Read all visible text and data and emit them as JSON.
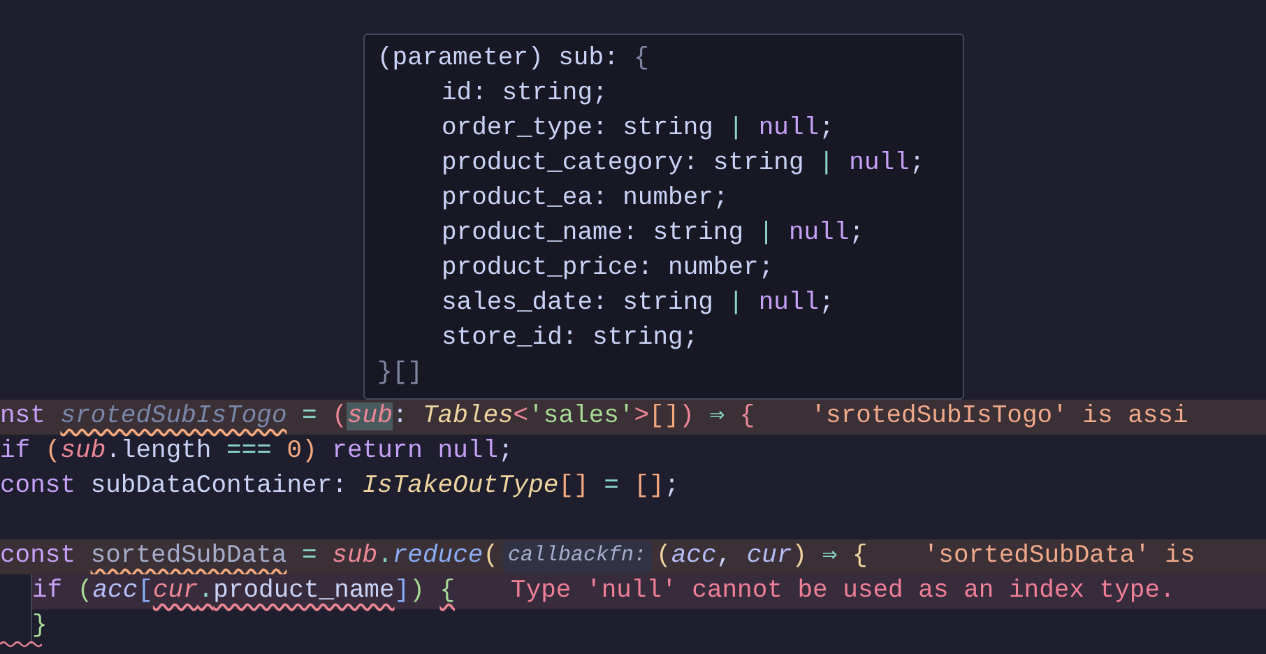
{
  "hover": {
    "lines": [
      {
        "indented": false,
        "tokens": [
          {
            "text": "(parameter) sub: ",
            "kind": "plain"
          },
          {
            "text": "{",
            "kind": "punct-grey"
          }
        ]
      },
      {
        "indented": true,
        "tokens": [
          {
            "text": "id: string;",
            "kind": "plain"
          }
        ]
      },
      {
        "indented": true,
        "tokens": [
          {
            "text": "order_type: string ",
            "kind": "plain"
          },
          {
            "text": "|",
            "kind": "operator"
          },
          {
            "text": " null",
            "kind": "keyword"
          },
          {
            "text": ";",
            "kind": "plain"
          }
        ]
      },
      {
        "indented": true,
        "tokens": [
          {
            "text": "product_category: string ",
            "kind": "plain"
          },
          {
            "text": "|",
            "kind": "operator"
          },
          {
            "text": " null",
            "kind": "keyword"
          },
          {
            "text": ";",
            "kind": "plain"
          }
        ]
      },
      {
        "indented": true,
        "tokens": [
          {
            "text": "product_ea: number;",
            "kind": "plain"
          }
        ]
      },
      {
        "indented": true,
        "tokens": [
          {
            "text": "product_name: string ",
            "kind": "plain"
          },
          {
            "text": "|",
            "kind": "operator"
          },
          {
            "text": " null",
            "kind": "keyword"
          },
          {
            "text": ";",
            "kind": "plain"
          }
        ]
      },
      {
        "indented": true,
        "tokens": [
          {
            "text": "product_price: number;",
            "kind": "plain"
          }
        ]
      },
      {
        "indented": true,
        "tokens": [
          {
            "text": "sales_date: string ",
            "kind": "plain"
          },
          {
            "text": "|",
            "kind": "operator"
          },
          {
            "text": " null",
            "kind": "keyword"
          },
          {
            "text": ";",
            "kind": "plain"
          }
        ]
      },
      {
        "indented": true,
        "tokens": [
          {
            "text": "store_id: string;",
            "kind": "plain"
          }
        ]
      },
      {
        "indented": false,
        "tokens": [
          {
            "text": "}[]",
            "kind": "punct-grey"
          }
        ]
      }
    ]
  },
  "code_lines": [
    {
      "kind": "warning",
      "indented": false,
      "diagnostic": "'srotedSubIsTogo' is assi",
      "tokens": [
        {
          "text": "nst ",
          "kind": "keyword"
        },
        {
          "text": "srotedSubIsTogo",
          "kind": "unused",
          "squiggle": true
        },
        {
          "text": " = ",
          "kind": "operator"
        },
        {
          "text": "(",
          "kind": "punct-pink"
        },
        {
          "text": "sub",
          "kind": "param",
          "highlight": true
        },
        {
          "text": ": ",
          "kind": "plain"
        },
        {
          "text": "Tables",
          "kind": "type"
        },
        {
          "text": "<",
          "kind": "punct-pink"
        },
        {
          "text": "'sales'",
          "kind": "string"
        },
        {
          "text": ">",
          "kind": "punct-pink"
        },
        {
          "text": "[]",
          "kind": "punct-orange"
        },
        {
          "text": ")",
          "kind": "punct-pink"
        },
        {
          "text": " ⇒ ",
          "kind": "operator"
        },
        {
          "text": "{",
          "kind": "punct-pink"
        }
      ]
    },
    {
      "kind": "normal",
      "indented": false,
      "tokens": [
        {
          "text": "if ",
          "kind": "keyword"
        },
        {
          "text": "(",
          "kind": "punct-orange"
        },
        {
          "text": "sub",
          "kind": "param"
        },
        {
          "text": ".length ",
          "kind": "plain"
        },
        {
          "text": "===",
          "kind": "operator"
        },
        {
          "text": " 0",
          "kind": "number"
        },
        {
          "text": ") ",
          "kind": "punct-orange"
        },
        {
          "text": "return null",
          "kind": "keyword"
        },
        {
          "text": ";",
          "kind": "plain"
        }
      ]
    },
    {
      "kind": "normal",
      "indented": false,
      "tokens": [
        {
          "text": "const ",
          "kind": "keyword"
        },
        {
          "text": "subDataContainer: ",
          "kind": "plain"
        },
        {
          "text": "IsTakeOutType",
          "kind": "type"
        },
        {
          "text": "[]",
          "kind": "punct-orange"
        },
        {
          "text": " = ",
          "kind": "operator"
        },
        {
          "text": "[]",
          "kind": "punct-orange"
        },
        {
          "text": ";",
          "kind": "plain"
        }
      ]
    },
    {
      "kind": "normal",
      "indented": false
    },
    {
      "kind": "warning",
      "indented": false,
      "diagnostic": "'sortedSubData' is",
      "tokens": [
        {
          "text": "const ",
          "kind": "keyword"
        },
        {
          "text": "sortedSubData",
          "kind": "dim",
          "squiggle": true
        },
        {
          "text": " = ",
          "kind": "operator"
        },
        {
          "text": "sub",
          "kind": "param"
        },
        {
          "text": ".",
          "kind": "operator"
        },
        {
          "text": "reduce",
          "kind": "method"
        },
        {
          "text": "(",
          "kind": "punct-yellow"
        },
        {
          "text": "callbackfn:",
          "kind": "hint"
        },
        {
          "text": "(",
          "kind": "punct-yellow"
        },
        {
          "text": "acc",
          "kind": "local"
        },
        {
          "text": ", ",
          "kind": "plain"
        },
        {
          "text": "cur",
          "kind": "local"
        },
        {
          "text": ")",
          "kind": "punct-yellow"
        },
        {
          "text": " ⇒ ",
          "kind": "operator"
        },
        {
          "text": "{",
          "kind": "punct-yellow"
        }
      ]
    },
    {
      "kind": "error",
      "indented": true,
      "diagnostic": "Type 'null' cannot be used as an index type.",
      "tokens": [
        {
          "text": "if ",
          "kind": "keyword"
        },
        {
          "text": "(",
          "kind": "punct-green"
        },
        {
          "text": "acc",
          "kind": "local"
        },
        {
          "text": "[",
          "kind": "punct-blue"
        },
        {
          "text": "cur",
          "kind": "param",
          "squiggle": true
        },
        {
          "text": ".",
          "kind": "operator",
          "squiggle": true
        },
        {
          "text": "product_name",
          "kind": "plain",
          "squiggle": true
        },
        {
          "text": "]",
          "kind": "punct-blue"
        },
        {
          "text": ") ",
          "kind": "punct-green"
        },
        {
          "text": "{",
          "kind": "punct-green",
          "squiggle": true
        }
      ]
    },
    {
      "kind": "normal",
      "indented": true,
      "tokens": [
        {
          "text": "}",
          "kind": "punct-green"
        }
      ]
    }
  ]
}
